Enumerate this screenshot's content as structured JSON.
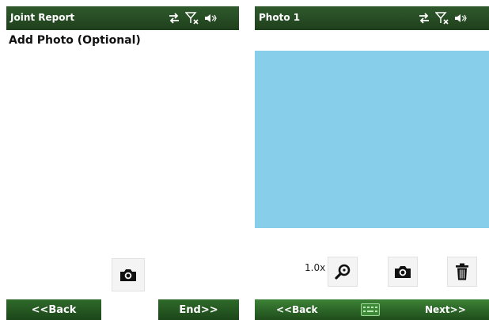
{
  "left_screen": {
    "title": "Joint Report",
    "heading": "Add Photo (Optional)",
    "softkeys": {
      "back": "<<Back",
      "end": "End>>"
    }
  },
  "right_screen": {
    "title": "Photo 1",
    "zoom_level": "1.0x",
    "softkeys": {
      "back": "<<Back",
      "next": "Next>>"
    }
  },
  "status_icons": [
    "sync-arrows-icon",
    "signal-off-icon",
    "speaker-muted-icon"
  ],
  "icons": {
    "camera_left": "camera-icon",
    "zoom": "magnifier-icon",
    "camera_right": "camera-icon",
    "delete": "trash-icon",
    "keyboard": "keyboard-icon"
  },
  "colors": {
    "titlebar": "#2a5227",
    "softkey": "#24541f",
    "photo_placeholder": "#87ceeb"
  }
}
